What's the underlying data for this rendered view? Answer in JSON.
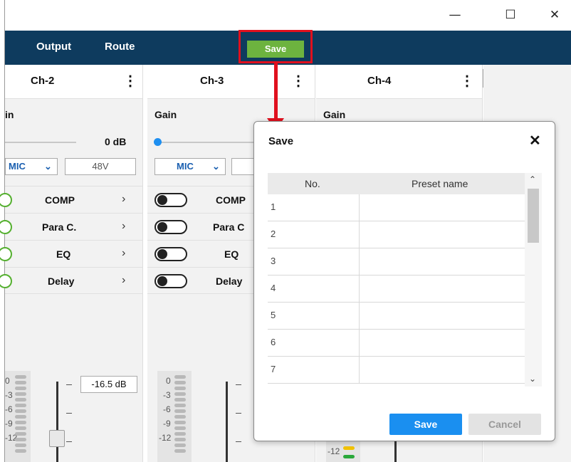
{
  "window": {
    "minimize": "—",
    "maximize": "☐",
    "close": "✕"
  },
  "nav": {
    "tabs": [
      "Output",
      "Route"
    ],
    "save_label": "Save",
    "preset_select_value": ""
  },
  "channels": [
    {
      "title": "Ch-2",
      "gain_label": "in",
      "gain_value": "0 dB",
      "source": "MIC",
      "phantom": "48V",
      "fx": [
        "COMP",
        "Para C.",
        "EQ",
        "Delay"
      ],
      "level": "-16.5 dB",
      "meter_labels": [
        "0",
        "-3",
        "-6",
        "-9",
        "-12"
      ]
    },
    {
      "title": "Ch-3",
      "gain_label": "Gain",
      "gain_value": "",
      "source": "MIC",
      "phantom": "",
      "fx": [
        "COMP",
        "Para C",
        "EQ",
        "Delay"
      ],
      "meter_labels": [
        "0",
        "-3",
        "-6",
        "-9",
        "-12"
      ]
    },
    {
      "title": "Ch-4",
      "gain_label": "Gain",
      "meter_labels": [
        "-12"
      ]
    }
  ],
  "dialog": {
    "title": "Save",
    "close": "✕",
    "columns": [
      "No.",
      "Preset name"
    ],
    "rows": [
      {
        "no": "1",
        "name": ""
      },
      {
        "no": "2",
        "name": ""
      },
      {
        "no": "3",
        "name": ""
      },
      {
        "no": "4",
        "name": ""
      },
      {
        "no": "5",
        "name": ""
      },
      {
        "no": "6",
        "name": ""
      },
      {
        "no": "7",
        "name": ""
      }
    ],
    "save_label": "Save",
    "cancel_label": "Cancel"
  },
  "colors": {
    "nav_bg": "#0e3b5e",
    "save_green": "#6db33f",
    "primary_blue": "#1a8ff0",
    "highlight_red": "#e0101e"
  }
}
